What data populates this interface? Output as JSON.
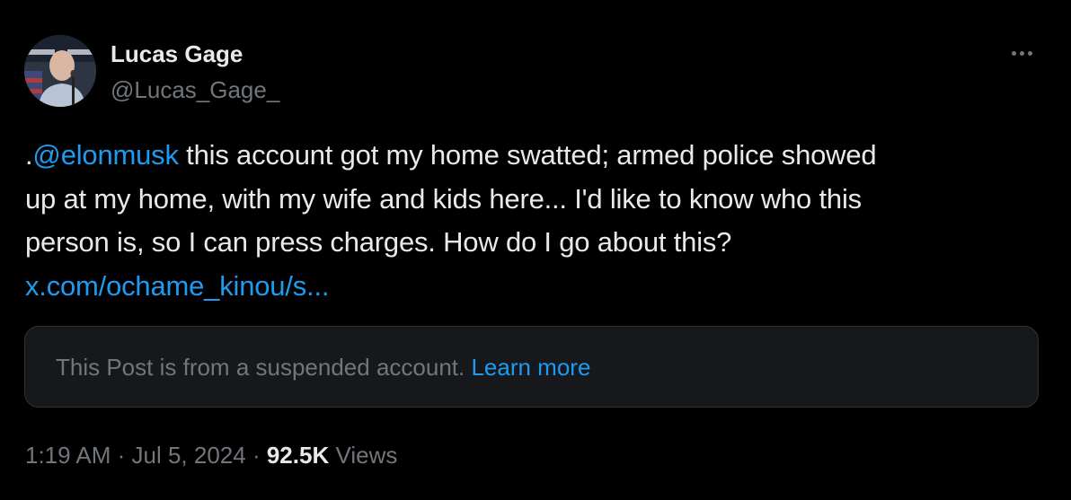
{
  "author": {
    "display_name": "Lucas Gage",
    "handle": "@Lucas_Gage_"
  },
  "tweet": {
    "prefix": ".",
    "mention": "@elonmusk",
    "line1_rest": " this account got my home swatted; armed police showed",
    "line2": "up at my home, with my wife and kids here... I'd like to know who this",
    "line3": "person is, so I can press charges. How do I go about this?",
    "link": "x.com/ochame_kinou/s..."
  },
  "notice": {
    "text": "This Post is from a suspended account. ",
    "link_label": "Learn more"
  },
  "meta": {
    "time": "1:19 AM",
    "separator1": " · ",
    "date": "Jul 5, 2024",
    "separator2": " · ",
    "views_count": "92.5K",
    "views_label": " Views"
  },
  "icons": {
    "more": "more-horizontal-icon",
    "avatar": "profile-photo"
  },
  "colors": {
    "background": "#000000",
    "text": "#e7e9ea",
    "secondary": "#71767b",
    "link": "#1d9bf0",
    "card_bg": "#16181c",
    "card_border": "#2f3336"
  }
}
